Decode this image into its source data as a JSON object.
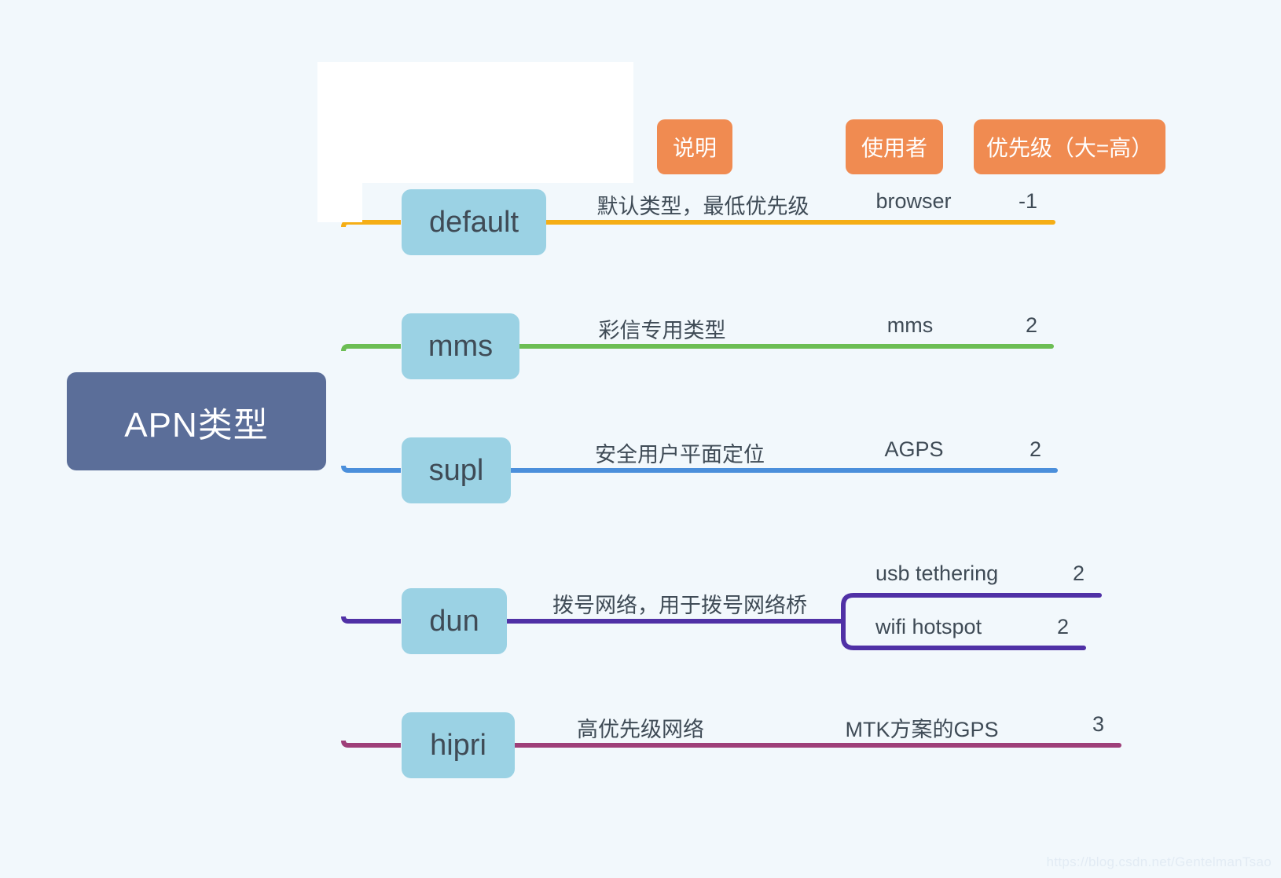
{
  "diagram": {
    "type": "mindmap",
    "background_color": "#f2f8fc",
    "root": {
      "label": "APN类型",
      "color": "#5b6e99",
      "text_color": "#ffffff"
    },
    "column_headers": [
      {
        "label": "说明",
        "color": "#f08b51"
      },
      {
        "label": "使用者",
        "color": "#f08b51"
      },
      {
        "label": "优先级（大=高）",
        "color": "#f08b51"
      }
    ],
    "branches": [
      {
        "name": "default",
        "description": "默认类型，最低优先级",
        "user": "browser",
        "priority": "-1",
        "line_color": "#f5ae16",
        "node_color": "#9bd2e4",
        "children": []
      },
      {
        "name": "mms",
        "description": "彩信专用类型",
        "user": "mms",
        "priority": "2",
        "line_color": "#6cbe54",
        "node_color": "#9bd2e4",
        "children": []
      },
      {
        "name": "supl",
        "description": "安全用户平面定位",
        "user": "AGPS",
        "priority": "2",
        "line_color": "#4b8fdb",
        "node_color": "#9bd2e4",
        "children": []
      },
      {
        "name": "dun",
        "description": "拨号网络，用于拨号网络桥",
        "user": "",
        "priority": "",
        "line_color": "#5031a6",
        "node_color": "#9bd2e4",
        "children": [
          {
            "user": "usb tethering",
            "priority": "2"
          },
          {
            "user": "wifi hotspot",
            "priority": "2"
          }
        ]
      },
      {
        "name": "hipri",
        "description": "高优先级网络",
        "user": "MTK方案的GPS",
        "priority": "3",
        "line_color": "#9e3f79",
        "node_color": "#9bd2e4",
        "children": []
      }
    ],
    "trunk": {
      "gradient_stops": [
        "#fa6a50",
        "#5031a6",
        "#9e3f79"
      ]
    }
  },
  "watermark": {
    "text": "https://blog.csdn.net/GentelmanTsao"
  }
}
